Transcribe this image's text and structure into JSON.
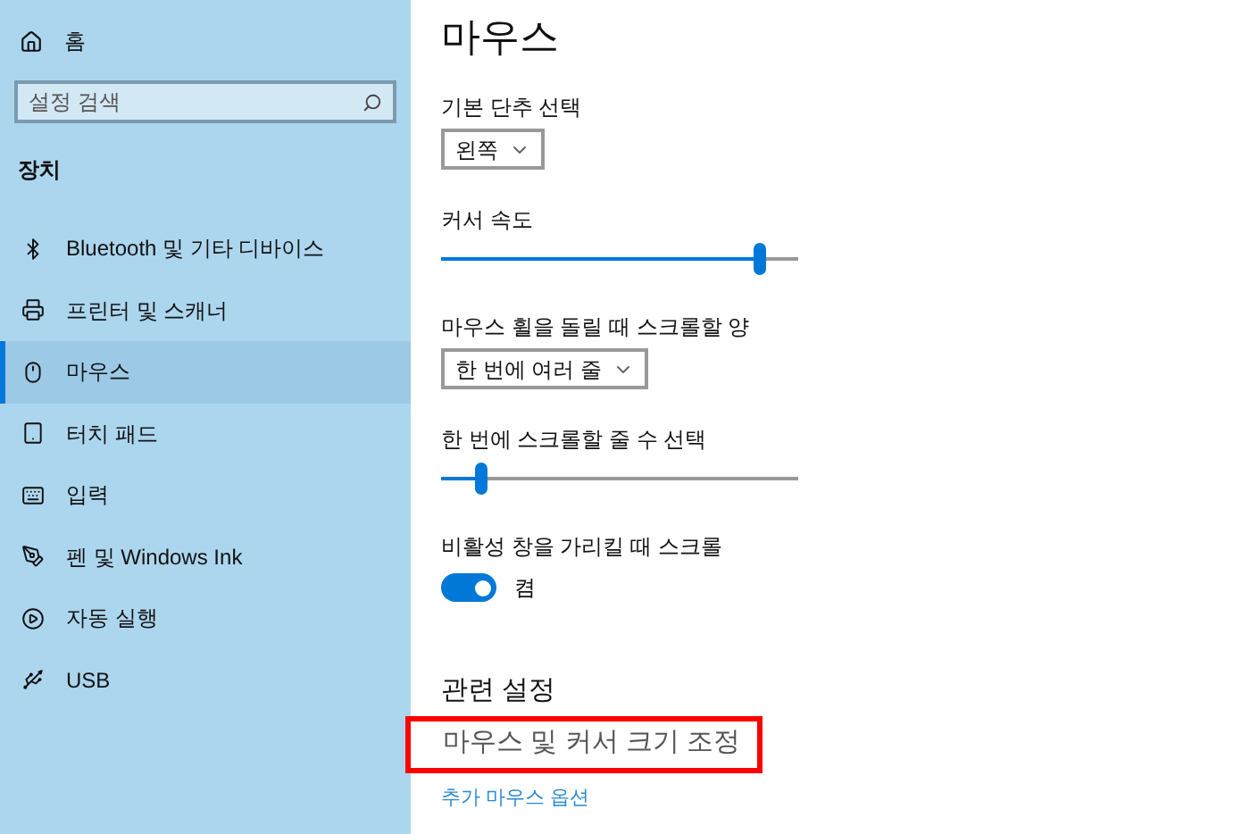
{
  "sidebar": {
    "home": "홈",
    "search": {
      "placeholder": "설정 검색"
    },
    "section": "장치",
    "items": [
      {
        "kind": "bluetooth",
        "label": "Bluetooth 및 기타 디바이스",
        "selected": false
      },
      {
        "kind": "printer",
        "label": "프린터 및 스캐너",
        "selected": false
      },
      {
        "kind": "mouse",
        "label": "마우스",
        "selected": true
      },
      {
        "kind": "touchpad",
        "label": "터치 패드",
        "selected": false
      },
      {
        "kind": "keyboard",
        "label": "입력",
        "selected": false
      },
      {
        "kind": "pen",
        "label": "펜 및 Windows Ink",
        "selected": false
      },
      {
        "kind": "autoplay",
        "label": "자동 실행",
        "selected": false
      },
      {
        "kind": "usb",
        "label": "USB",
        "selected": false
      }
    ]
  },
  "main": {
    "title": "마우스",
    "settings": [
      {
        "kind": "dropdown",
        "label": "기본 단추 선택",
        "value": "왼쪽"
      },
      {
        "kind": "slider",
        "label": "커서 속도",
        "level": 0.89
      },
      {
        "kind": "dropdown",
        "label": "마우스 휠을 돌릴 때 스크롤할 양",
        "value": "한 번에 여러 줄"
      },
      {
        "kind": "slider",
        "label": "한 번에 스크롤할 줄 수 선택",
        "level": 0.11
      },
      {
        "kind": "toggle",
        "label": "비활성 창을 가리킬 때 스크롤",
        "on": true,
        "state_text": "켬"
      }
    ],
    "related": {
      "title": "관련 설정",
      "links": [
        {
          "label": "마우스 및 커서 크기 조정",
          "highlighted": true
        },
        {
          "label": "추가 마우스 옵션",
          "highlighted": false
        }
      ]
    }
  }
}
